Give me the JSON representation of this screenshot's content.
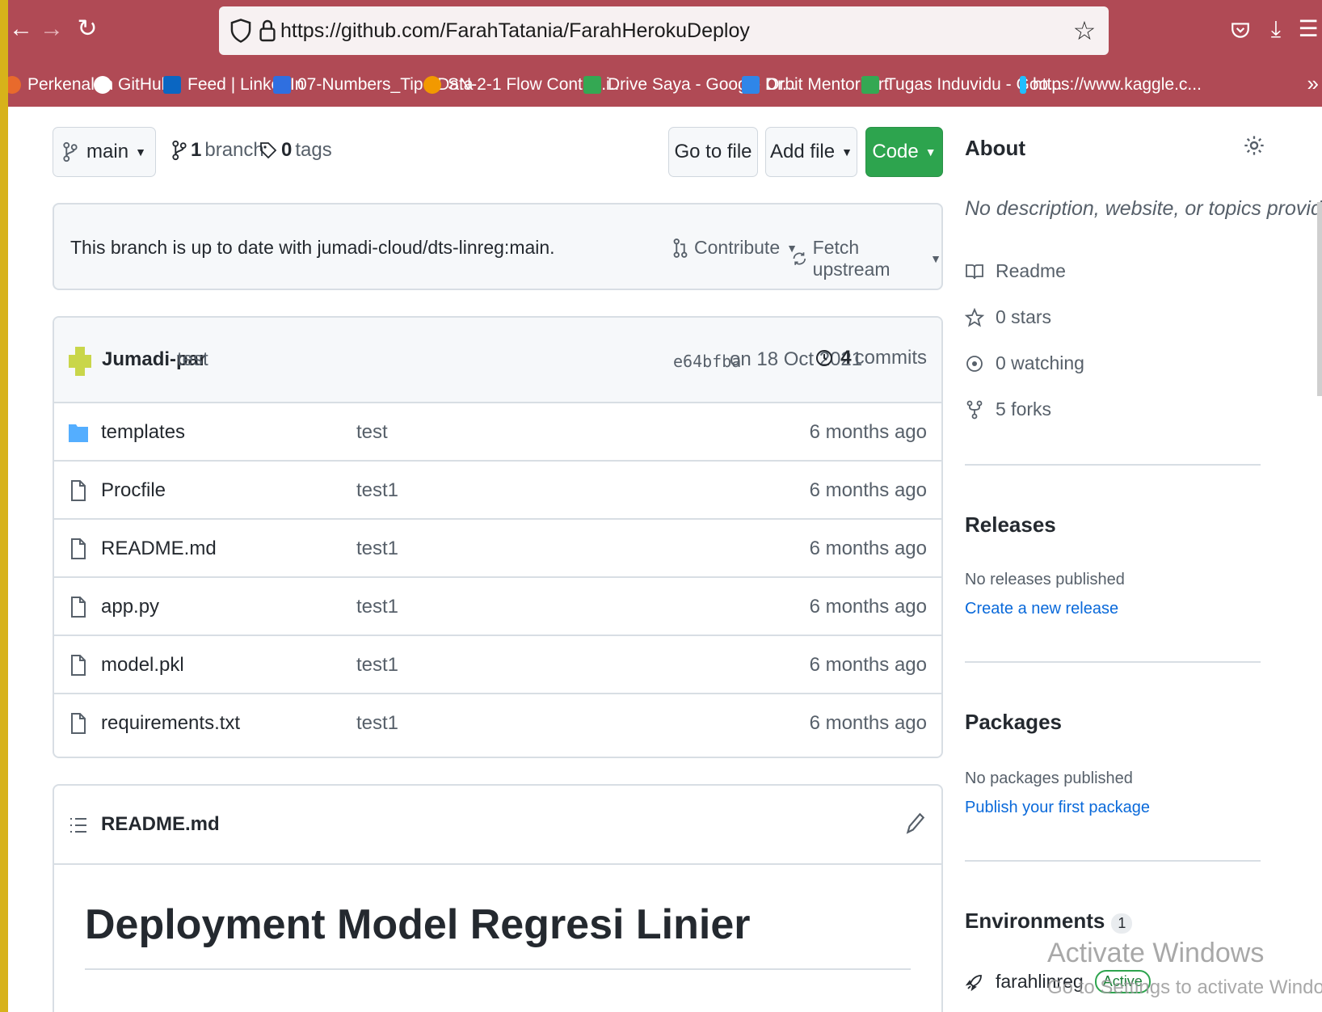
{
  "browser": {
    "url": "https://github.com/FarahTatania/FarahHerokuDeploy",
    "bookmarks": [
      {
        "label": "Perkenalan",
        "icon": "firefox-icon",
        "color": "#e86a2c"
      },
      {
        "label": "GitHub",
        "icon": "github-icon",
        "color": "#ffffff"
      },
      {
        "label": "Feed | LinkedIn",
        "icon": "linkedin-icon",
        "color": "#0a66c2"
      },
      {
        "label": "07-Numbers_Tipe Data",
        "icon": "doc-icon",
        "color": "#2f6fe0"
      },
      {
        "label": "SN-2-1 Flow Control.i...",
        "icon": "colab-icon",
        "color": "#f29900"
      },
      {
        "label": "Drive Saya - Google Dr...",
        "icon": "drive-icon",
        "color": "#34a853"
      },
      {
        "label": "Orbit Mentorkart",
        "icon": "check-icon",
        "color": "#2f86e8"
      },
      {
        "label": "Tugas Induvidu - Goo...",
        "icon": "drive-icon",
        "color": "#34a853"
      },
      {
        "label": "https://www.kaggle.c...",
        "icon": "kaggle-icon",
        "color": "#20beff"
      }
    ]
  },
  "repo": {
    "branch_selector": "main",
    "branch_count": "1",
    "branch_label": "branch",
    "tag_count": "0",
    "tag_label": "tags",
    "go_to_file": "Go to file",
    "add_file": "Add file",
    "code": "Code"
  },
  "banner": {
    "message": "This branch is up to date with jumadi-cloud/dts-linreg:main.",
    "contribute": "Contribute",
    "fetch_upstream": "Fetch upstream"
  },
  "commit": {
    "author": "Jumadi-par",
    "message": "test",
    "sha": "e64bfba",
    "date": "on 18 Oct 2021",
    "count": "4",
    "count_label": "commits"
  },
  "files": [
    {
      "name": "templates",
      "type": "folder",
      "message": "test",
      "age": "6 months ago"
    },
    {
      "name": "Procfile",
      "type": "file",
      "message": "test1",
      "age": "6 months ago"
    },
    {
      "name": "README.md",
      "type": "file",
      "message": "test1",
      "age": "6 months ago"
    },
    {
      "name": "app.py",
      "type": "file",
      "message": "test1",
      "age": "6 months ago"
    },
    {
      "name": "model.pkl",
      "type": "file",
      "message": "test1",
      "age": "6 months ago"
    },
    {
      "name": "requirements.txt",
      "type": "file",
      "message": "test1",
      "age": "6 months ago"
    }
  ],
  "readme": {
    "filename": "README.md",
    "heading": "Deployment Model Regresi Linier"
  },
  "sidebar": {
    "about_title": "About",
    "description": "No description, website, or topics provided.",
    "items": [
      {
        "label": "Readme",
        "icon": "book-icon"
      },
      {
        "label": "0 stars",
        "icon": "star-icon"
      },
      {
        "label": "0 watching",
        "icon": "eye-icon"
      },
      {
        "label": "5 forks",
        "icon": "fork-icon"
      }
    ],
    "releases_title": "Releases",
    "releases_empty": "No releases published",
    "releases_link": "Create a new release",
    "packages_title": "Packages",
    "packages_empty": "No packages published",
    "packages_link": "Publish your first package",
    "environments_title": "Environments",
    "environments_count": "1",
    "environment_name": "farahlinreg",
    "environment_status": "Active"
  },
  "watermark": {
    "line1": "Activate Windows",
    "line2": "Go to Settings to activate Windows."
  },
  "colors": {
    "browser_chrome": "#b04a55",
    "code_button": "#2da44e",
    "link": "#0969da",
    "folder": "#54aeff"
  }
}
